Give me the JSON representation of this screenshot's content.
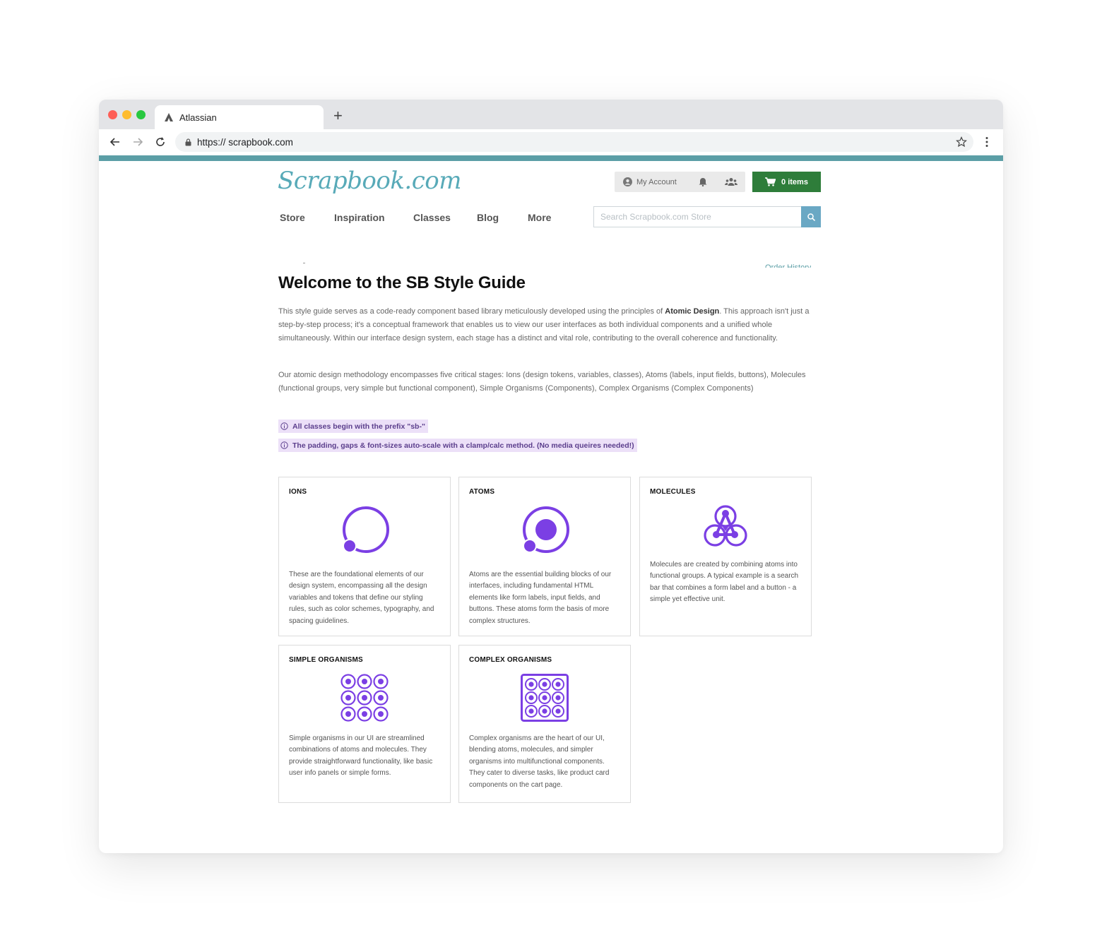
{
  "browser": {
    "tab_title": "Atlassian",
    "new_tab": "+",
    "url_scheme": "https://",
    "url_host": "scrapbook.com"
  },
  "header": {
    "logo": "Scrapbook.com",
    "my_account": "My Account",
    "cart": "0 items",
    "nav": [
      "Store",
      "Inspiration",
      "Classes",
      "Blog",
      "More"
    ],
    "search_placeholder": "Search Scrapbook.com Store",
    "order_history": "Order History"
  },
  "main": {
    "title": "Welcome to the SB Style Guide",
    "para1_a": "This style guide serves as a code-ready component based library meticulously developed using the principles of ",
    "para1_bold": "Atomic Design",
    "para1_b": ". This approach isn't just a step-by-step process; it's a conceptual framework that enables us to view our user interfaces as both individual components and a unified whole simultaneously. Within our interface design system, each stage has a distinct and vital role, contributing to the overall coherence and functionality.",
    "para2": "Our atomic design methodology encompasses five critical stages: Ions (design tokens, variables, classes), Atoms (labels, input fields, buttons), Molecules (functional groups, very simple but functional component), Simple Organisms (Components), Complex Organisms (Complex Components)",
    "callouts": [
      "All classes begin with the prefix \"sb-\"",
      "The padding, gaps & font-sizes auto-scale with a clamp/calc method. (No media queires needed!)"
    ]
  },
  "cards": [
    {
      "title": "IONS",
      "text": "These are the foundational elements of our design system, encompassing all the design variables and tokens that define our styling rules, such as color schemes, typography, and spacing guidelines."
    },
    {
      "title": "ATOMS",
      "text": "Atoms are the essential building blocks of our interfaces, including fundamental HTML elements like form labels, input fields, and buttons. These atoms form the basis of more complex structures."
    },
    {
      "title": "MOLECULES",
      "text": "Molecules are created by combining atoms into functional groups. A typical example is a search bar that combines a form label and a button - a simple yet effective unit."
    },
    {
      "title": "SIMPLE ORGANISMS",
      "text": "Simple organisms in our UI are streamlined combinations of atoms and molecules. They provide straightforward functionality, like basic user info panels or simple forms."
    },
    {
      "title": "COMPLEX ORGANISMS",
      "text": "Complex organisms are the heart of our UI, blending atoms, molecules, and simpler organisms into multifunctional components. They cater to diverse tasks, like product card components on the cart page."
    }
  ],
  "colors": {
    "accent_purple": "#7b3fe4",
    "stripe": "#5b9ea6",
    "cart_green": "#2e7d3a",
    "search_button": "#6aa8c4",
    "callout_bg": "#ece0f8"
  },
  "icons": [
    "atlassian-icon",
    "back-arrow-icon",
    "forward-arrow-icon",
    "reload-icon",
    "lock-icon",
    "star-icon",
    "kebab-menu-icon",
    "user-icon",
    "bell-icon",
    "group-icon",
    "cart-icon",
    "search-icon",
    "info-icon",
    "ion-icon",
    "atom-icon",
    "molecule-icon",
    "simple-organism-icon",
    "complex-organism-icon"
  ]
}
